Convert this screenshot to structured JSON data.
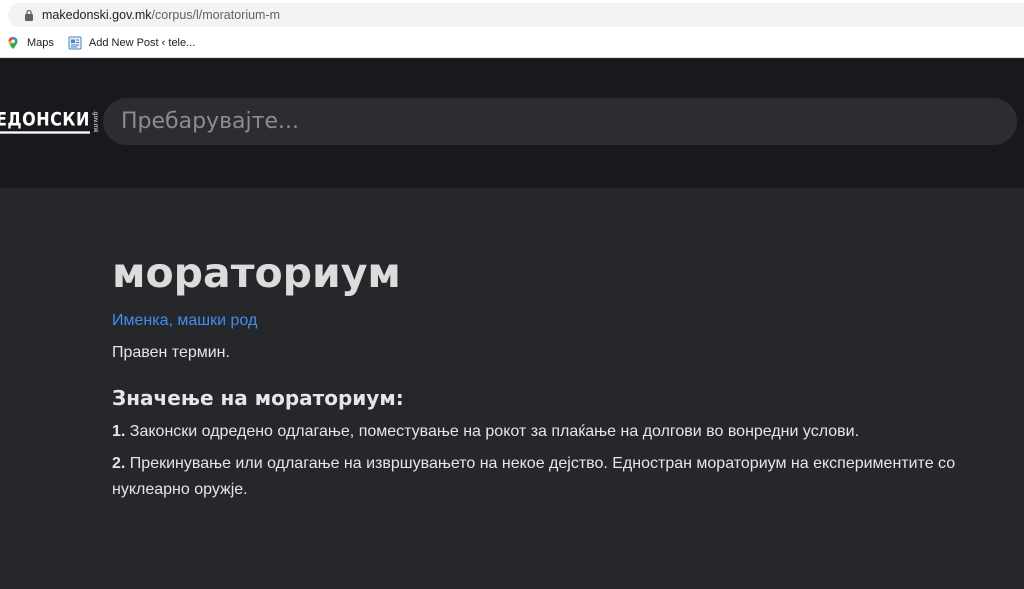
{
  "browser": {
    "url_domain": "makedonski.gov.mk",
    "url_path": "/corpus/l/moratorium-m",
    "bookmarks": [
      {
        "label": "Maps",
        "icon": "maps-icon"
      },
      {
        "label": "Add New Post ‹ tele...",
        "icon": "page-icon"
      }
    ]
  },
  "site": {
    "logo_text": "ЕДОНСКИ",
    "logo_suffix": ".gov.mk",
    "search_placeholder": "Пребарувајте..."
  },
  "entry": {
    "word": "мораториум",
    "pos": "Именка",
    "separator": ",",
    "gender": "машки род",
    "note": "Правен термин.",
    "meaning_heading": "Значење на мораториум:",
    "definitions": [
      {
        "num": "1.",
        "text": "Законски одредено одлагање, поместување на рокот за плаќање на долгови во вонредни услови."
      },
      {
        "num": "2.",
        "text": "Прекинување или одлагање на извршувањето на некое дејство. Еднostran мораториум на експериментите со нуклеарно оружје."
      }
    ]
  },
  "colors": {
    "header_bg": "#17191c",
    "page_bg": "#25272b",
    "link": "#3d8ff0"
  }
}
